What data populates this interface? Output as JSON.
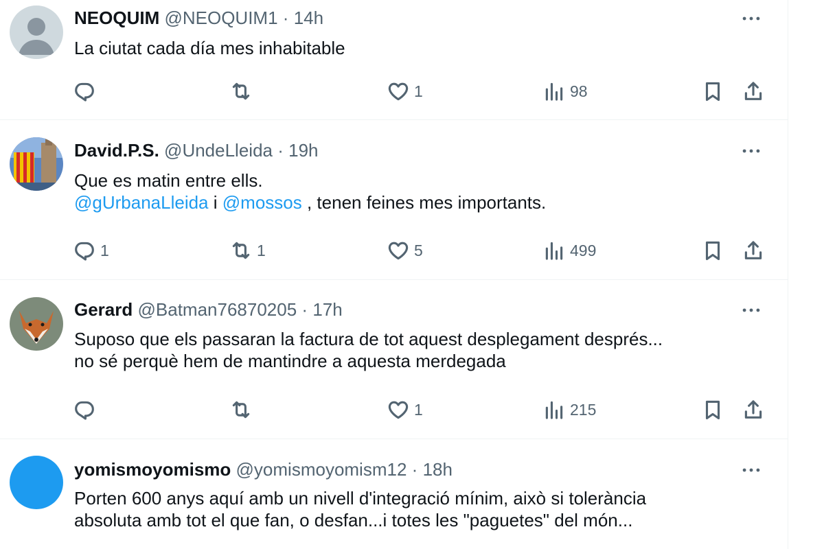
{
  "tweets": [
    {
      "name": "NEOQUIM",
      "handle": "@NEOQUIM1",
      "sep": "·",
      "time": "14h",
      "lines": [
        "La ciutat cada día mes inhabitable"
      ],
      "replies": "",
      "retweets": "",
      "likes": "1",
      "views": "98",
      "avatar": "avatar-default-icon"
    },
    {
      "name": "David.P.S.",
      "handle": "@UndeLleida",
      "sep": "·",
      "time": "19h",
      "line1": "Que es matin entre ells.",
      "mention1": "@gUrbanaLleida",
      "mid": " i ",
      "mention2": "@mossos",
      "tail": " , tenen feines mes importants.",
      "replies": "1",
      "retweets": "1",
      "likes": "5",
      "views": "499",
      "avatar": "avatar-flag-photo"
    },
    {
      "name": "Gerard",
      "handle": "@Batman76870205",
      "sep": "·",
      "time": "17h",
      "lines": [
        "Suposo que els passaran la factura de tot aquest desplegament després...",
        "no sé perquè hem de mantindre a aquesta merdegada"
      ],
      "replies": "",
      "retweets": "",
      "likes": "1",
      "views": "215",
      "avatar": "avatar-fox-photo"
    },
    {
      "name": "yomismoyomismo",
      "handle": "@yomismoyomism12",
      "sep": "·",
      "time": "18h",
      "lines": [
        "Porten 600 anys aquí amb un nivell d'integració mínim, això si tolerància",
        "absoluta amb tot el que fan, o desfan...i totes les \"paguetes\" del món..."
      ],
      "avatar": "avatar-blue-circle"
    }
  ],
  "colors": {
    "text": "#0f1419",
    "secondary": "#536471",
    "link": "#1d9bf0",
    "divider": "#eff3f4",
    "avatar_default_bg": "#cfd9de",
    "avatar_blue": "#1d9bf0"
  }
}
